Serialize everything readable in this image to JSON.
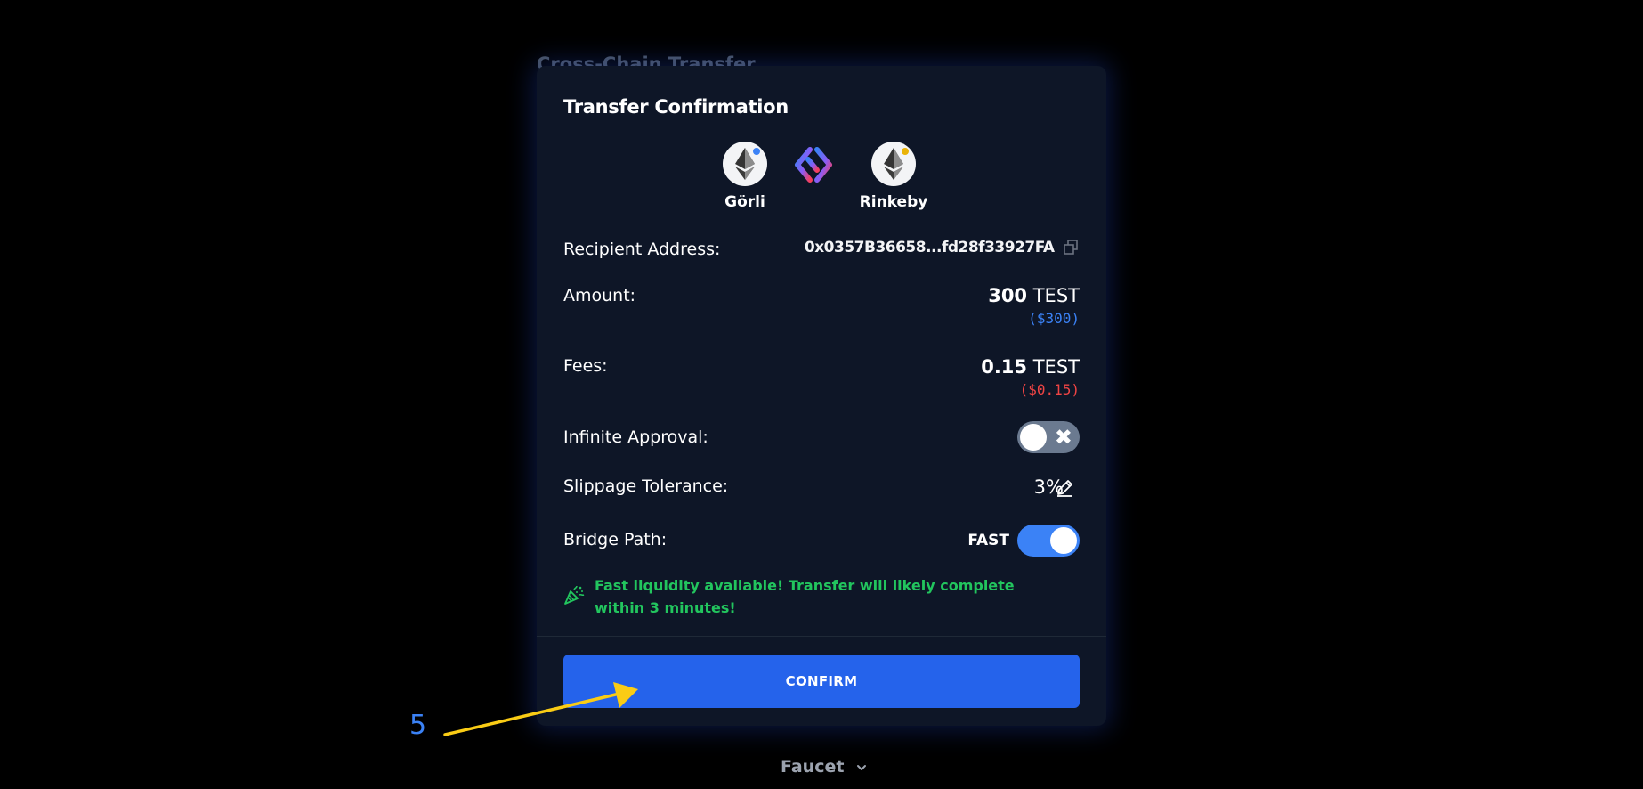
{
  "background": {
    "title": "Cross-Chain Transfer"
  },
  "modal": {
    "title": "Transfer Confirmation",
    "from_chain": {
      "name": "Görli",
      "icon": "ethereum-icon",
      "dot_color": "#3b82f6"
    },
    "to_chain": {
      "name": "Rinkeby",
      "icon": "ethereum-icon",
      "dot_color": "#eab308"
    },
    "recipient": {
      "label": "Recipient Address:",
      "value": "0x0357B36658...fd28f33927FA"
    },
    "amount": {
      "label": "Amount:",
      "value": "300",
      "token": "TEST",
      "usd": "($300)",
      "usd_color": "#3b82f6"
    },
    "fees": {
      "label": "Fees:",
      "value": "0.15",
      "token": "TEST",
      "usd": "($0.15)",
      "usd_color": "#ef4444"
    },
    "infinite_approval": {
      "label": "Infinite Approval:",
      "enabled": false
    },
    "slippage": {
      "label": "Slippage Tolerance:",
      "value": "3%"
    },
    "bridge_path": {
      "label": "Bridge Path:",
      "mode": "FAST",
      "enabled": true
    },
    "notice": {
      "icon": "party-popper-icon",
      "text": "Fast liquidity available! Transfer will likely complete within 3 minutes!",
      "color": "#22c55e"
    },
    "confirm_label": "CONFIRM"
  },
  "annotation": {
    "number": "5",
    "color": "#facc15"
  },
  "footer": {
    "label": "Faucet"
  },
  "colors": {
    "page_bg": "#000000",
    "modal_bg": "#0e1627",
    "accent": "#2563eb",
    "toggle_on": "#3b82f6",
    "toggle_off": "#6b7a90"
  }
}
